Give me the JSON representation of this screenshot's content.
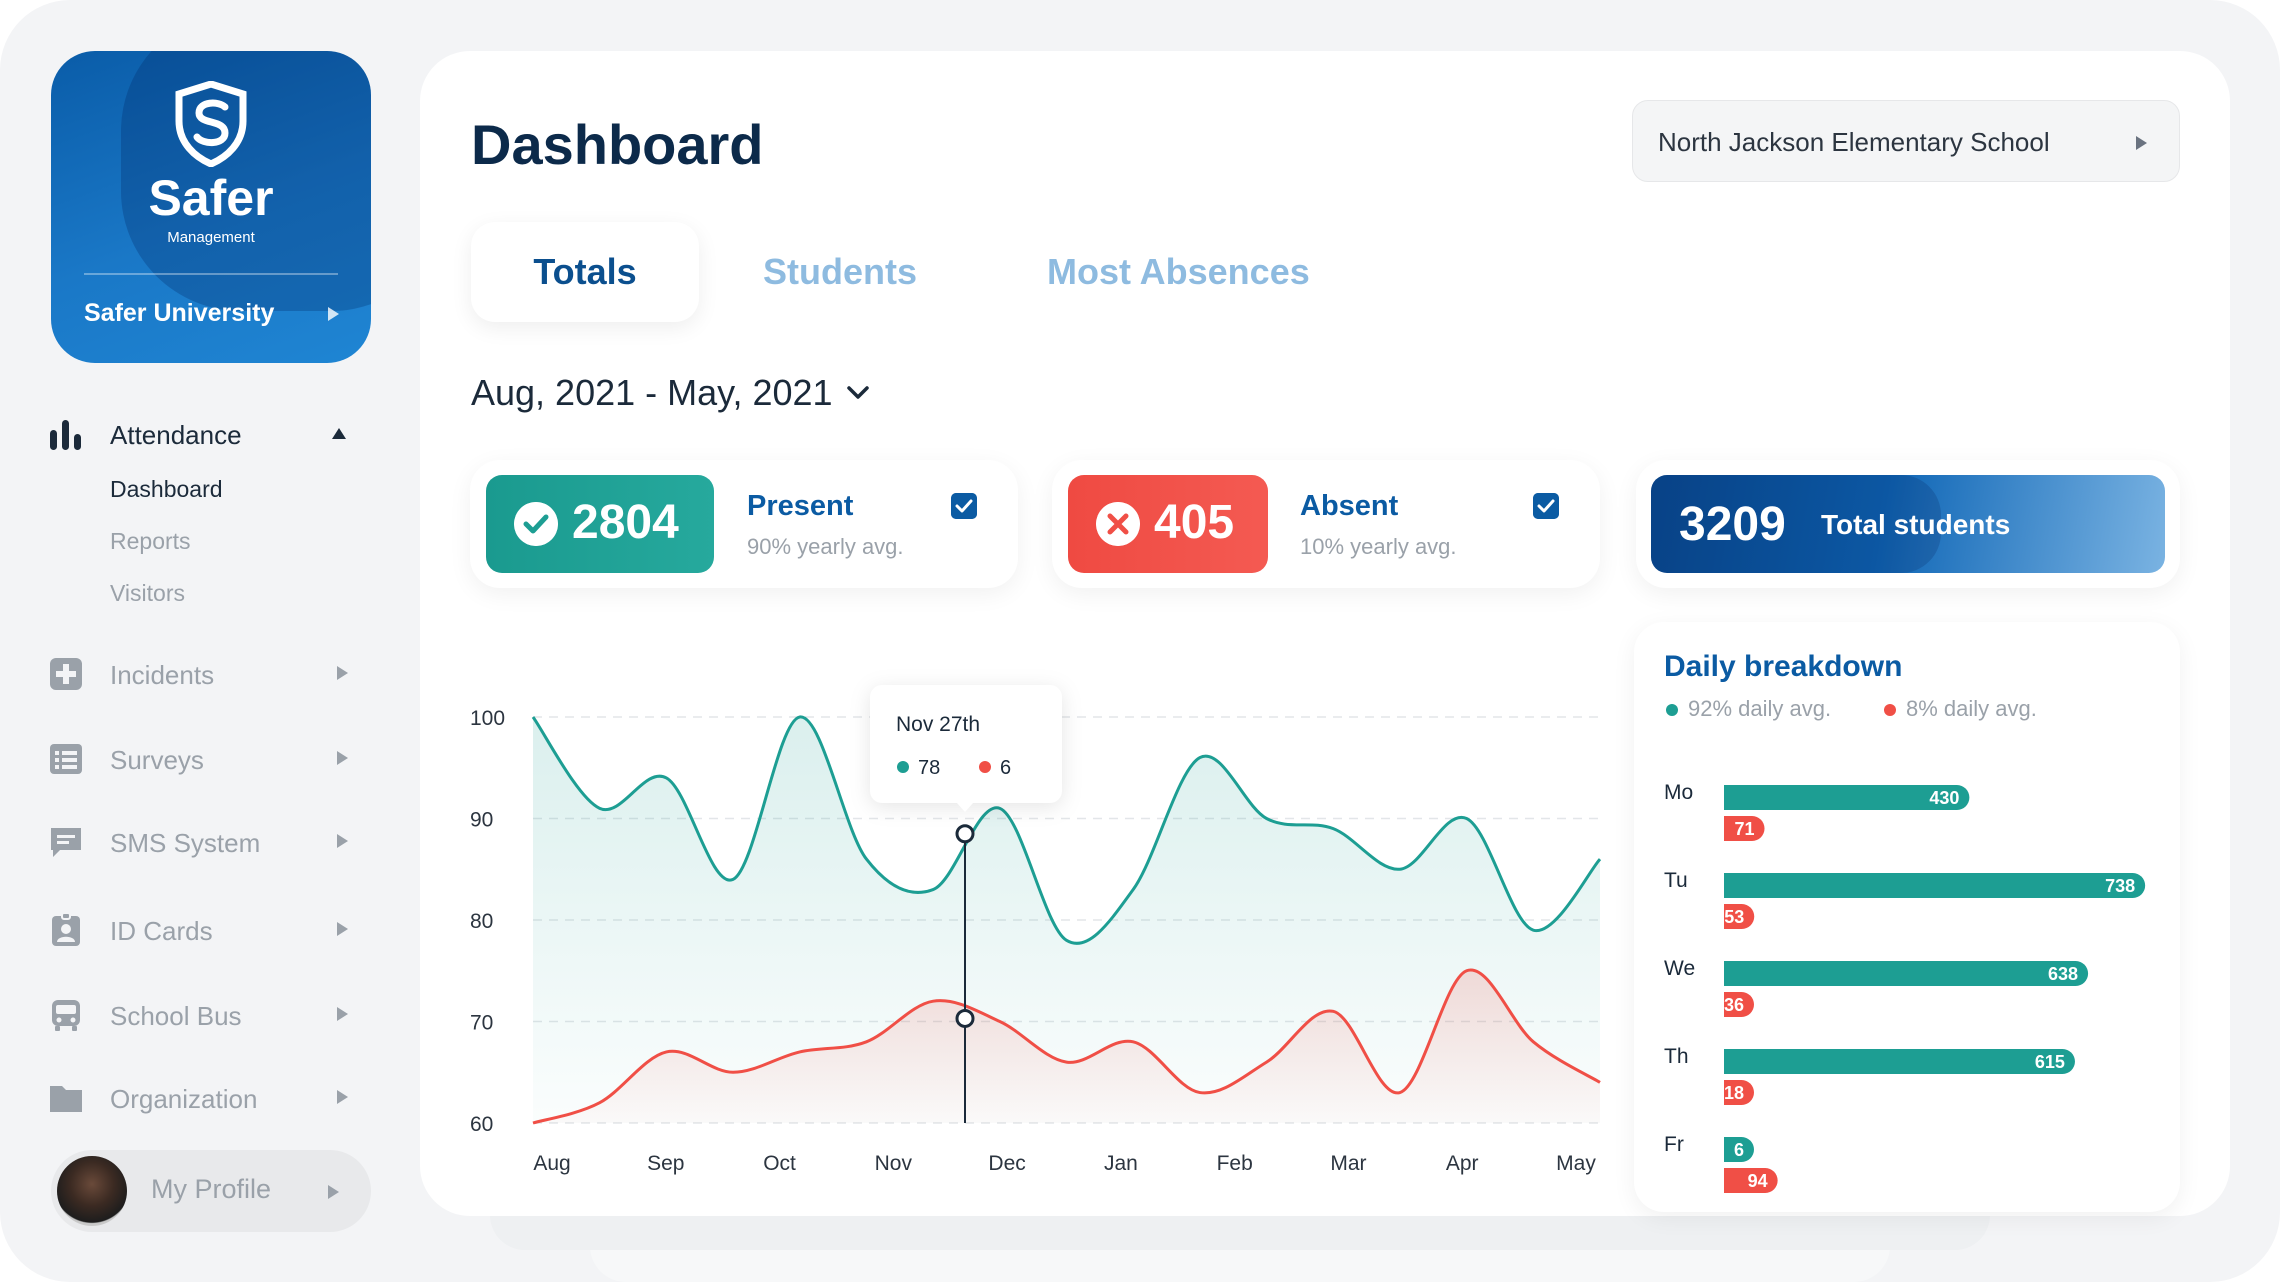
{
  "brand": {
    "name": "Safer",
    "subtitle": "Management",
    "org": "Safer University"
  },
  "sidebar": {
    "attendance": {
      "label": "Attendance",
      "items": [
        "Dashboard",
        "Reports",
        "Visitors"
      ]
    },
    "items": [
      {
        "label": "Incidents",
        "icon": "medical-cross-icon"
      },
      {
        "label": "Surveys",
        "icon": "list-icon"
      },
      {
        "label": "SMS System",
        "icon": "chat-icon"
      },
      {
        "label": "ID Cards",
        "icon": "id-badge-icon"
      },
      {
        "label": "School Bus",
        "icon": "bus-icon"
      },
      {
        "label": "Organization",
        "icon": "folder-icon"
      }
    ],
    "profile": "My Profile"
  },
  "header": {
    "title": "Dashboard",
    "school": "North Jackson Elementary School"
  },
  "tabs": [
    "Totals",
    "Students",
    "Most Absences"
  ],
  "date_range": "Aug, 2021 - May, 2021",
  "stats": {
    "present": {
      "value": "2804",
      "label": "Present",
      "avg": "90% yearly avg."
    },
    "absent": {
      "value": "405",
      "label": "Absent",
      "avg": "10% yearly avg."
    },
    "total": {
      "value": "3209",
      "label": "Total students"
    }
  },
  "colors": {
    "teal": "#1d9e93",
    "red": "#f04f46",
    "blue": "#0b5ba3",
    "navy": "#0c2a4a"
  },
  "chart_data": [
    {
      "type": "area",
      "x": [
        "Aug",
        "Sep",
        "Oct",
        "Nov",
        "Dec",
        "Jan",
        "Feb",
        "Mar",
        "Apr",
        "May"
      ],
      "ylim": [
        60,
        100
      ],
      "yticks": [
        60,
        70,
        80,
        90,
        100
      ],
      "series": [
        {
          "color": "#1d9e93",
          "values": [
            100,
            91,
            94,
            84,
            100,
            86,
            83,
            91,
            78,
            83,
            96,
            90,
            89,
            85,
            90,
            79,
            86
          ]
        },
        {
          "color": "#f04f46",
          "values": [
            60,
            62,
            67,
            65,
            67,
            68,
            72,
            70,
            66,
            68,
            63,
            66,
            71,
            63,
            75,
            68,
            64
          ]
        }
      ],
      "tooltip": {
        "title": "Nov 27th",
        "present": "78",
        "absent": "6"
      }
    },
    {
      "type": "bar",
      "title": "Daily breakdown",
      "legend": [
        "92% daily avg.",
        "8% daily avg."
      ],
      "categories": [
        "Mo",
        "Tu",
        "We",
        "Th",
        "Fr"
      ],
      "series": [
        {
          "color": "#1d9e93",
          "values": [
            430,
            738,
            638,
            615,
            6
          ]
        },
        {
          "color": "#f04f46",
          "values": [
            71,
            53,
            36,
            18,
            94
          ]
        }
      ]
    }
  ]
}
